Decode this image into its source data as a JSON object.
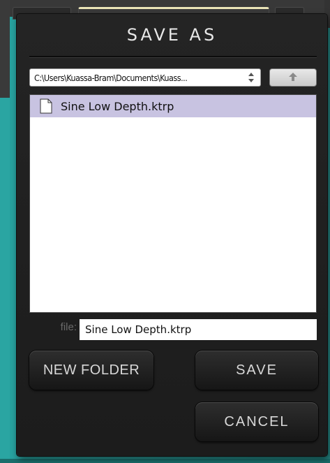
{
  "dialog": {
    "title": "SAVE AS",
    "path": "C:\\Users\\Kuassa-Bram\\Documents\\Kuass...",
    "path_select_icon": "updown-arrows-icon",
    "up_button_icon": "arrow-up-icon",
    "files": [
      {
        "name": "Sine Low Depth.ktrp",
        "icon": "file-icon",
        "selected": true
      }
    ],
    "file_label": "file:",
    "file_value": "Sine Low Depth.ktrp",
    "new_folder_label": "NEW FOLDER",
    "save_label": "SAVE",
    "cancel_label": "CANCEL"
  },
  "colors": {
    "dialog_bg": "#1f1f1f",
    "selected_row": "#c8c3e1",
    "background": "#2a9c9a"
  }
}
